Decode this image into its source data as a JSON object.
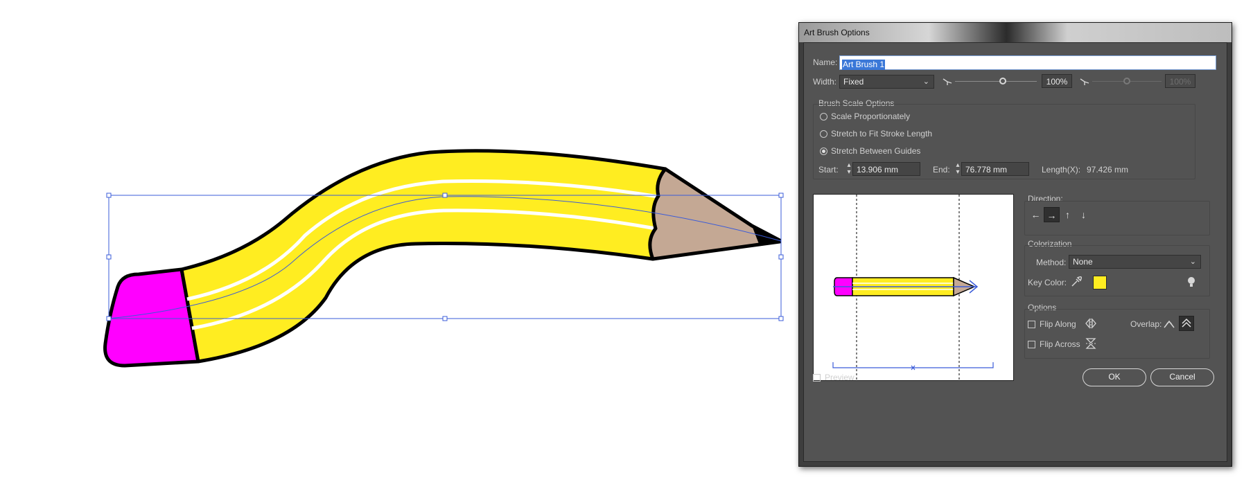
{
  "dialog": {
    "title": "Art Brush Options",
    "name_label": "Name:",
    "name_value": "Art Brush 1",
    "width_label": "Width:",
    "width_select": "Fixed",
    "width_percent": "100%",
    "width_percent_right": "100%",
    "brush_scale": {
      "title": "Brush Scale Options",
      "options": [
        "Scale Proportionately",
        "Stretch to Fit Stroke Length",
        "Stretch Between Guides"
      ],
      "selected": "Stretch Between Guides",
      "start_label": "Start:",
      "start_value": "13.906 mm",
      "end_label": "End:",
      "end_value": "76.778 mm",
      "length_label": "Length(X):",
      "length_value": "97.426 mm"
    },
    "direction": {
      "title": "Direction:",
      "buttons": [
        "←",
        "→",
        "↑",
        "↓"
      ],
      "selected": "→"
    },
    "colorization": {
      "title": "Colorization",
      "method_label": "Method:",
      "method_value": "None",
      "key_color_label": "Key Color:",
      "key_color": "#ffed21"
    },
    "options": {
      "title": "Options",
      "flip_along": "Flip Along",
      "flip_across": "Flip Across",
      "overlap_label": "Overlap:"
    },
    "preview_label": "Preview",
    "ok_label": "OK",
    "cancel_label": "Cancel"
  },
  "colors": {
    "pencil_body": "#ffed21",
    "eraser": "#ff00ff",
    "wood": "#c4a894",
    "selection": "#3a5bd9",
    "dialog_bg": "#535353"
  },
  "icons": [
    "width-profile-icon",
    "eyedropper-icon",
    "tips-bulb-icon",
    "flip-along-icon",
    "flip-across-icon",
    "overlap-adjust-icon",
    "overlap-hide-icon"
  ]
}
